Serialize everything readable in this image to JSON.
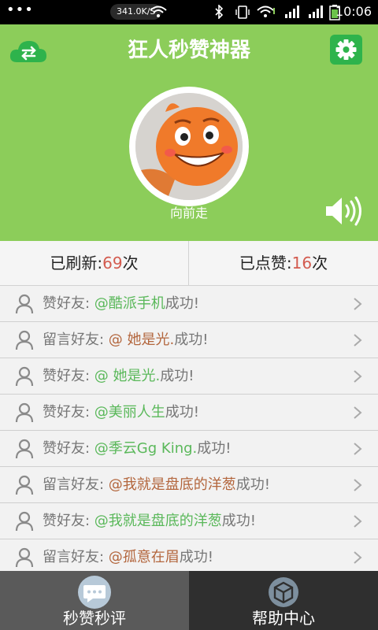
{
  "status_bar": {
    "network_speed": "341.0K/S",
    "time": "10:06"
  },
  "header": {
    "title": "狂人秒赞神器",
    "username": "向前走",
    "icons": [
      "cloud-sync-icon",
      "gear-icon",
      "speaker-icon"
    ]
  },
  "stats": {
    "refreshed_label": "已刷新:",
    "refreshed_count": "69",
    "refreshed_unit": "次",
    "liked_label": "已点赞:",
    "liked_count": "16",
    "liked_unit": "次"
  },
  "log": {
    "items": [
      {
        "prefix": "赞好友: ",
        "target": "@酷派手机",
        "suffix": "成功!",
        "kind": "like"
      },
      {
        "prefix": "留言好友: ",
        "target": "@ 她是光.",
        "suffix": "成功!",
        "kind": "msg"
      },
      {
        "prefix": "赞好友: ",
        "target": "@ 她是光.",
        "suffix": "成功!",
        "kind": "like"
      },
      {
        "prefix": "赞好友: ",
        "target": "@美丽人生",
        "suffix": "成功!",
        "kind": "like"
      },
      {
        "prefix": "赞好友: ",
        "target": "@季云Gg King.",
        "suffix": "成功!",
        "kind": "like"
      },
      {
        "prefix": "留言好友: ",
        "target": "@我就是盘底的洋葱",
        "suffix": "成功!",
        "kind": "msg"
      },
      {
        "prefix": "赞好友: ",
        "target": "@我就是盘底的洋葱",
        "suffix": "成功!",
        "kind": "like"
      },
      {
        "prefix": "留言好友: ",
        "target": "@孤意在眉",
        "suffix": "成功!",
        "kind": "msg"
      }
    ]
  },
  "bottom_nav": {
    "tab1_label": "秒赞秒评",
    "tab2_label": "帮助中心"
  },
  "colors": {
    "header_green": "#8ccd5a",
    "gear_green": "#2eb34c",
    "like_target": "#5ab85a",
    "msg_target": "#b3663d",
    "count_red": "#d35b4f"
  }
}
